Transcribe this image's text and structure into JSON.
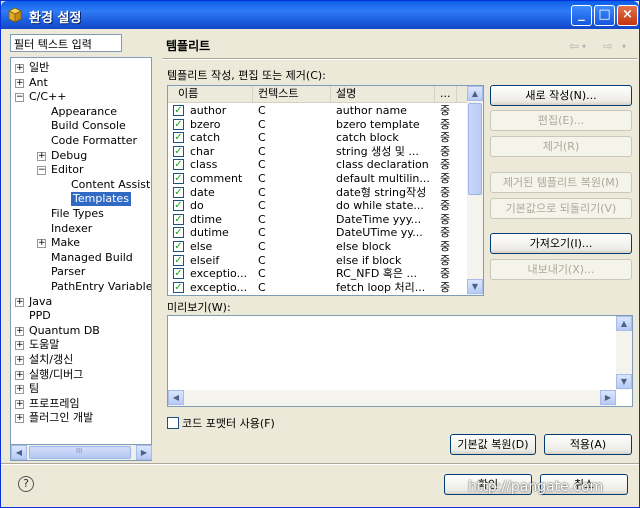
{
  "window": {
    "title": "환경 설정"
  },
  "filter": {
    "placeholder": "필터 텍스트 입력"
  },
  "tree": {
    "items": [
      {
        "label": "일반",
        "exp": "+"
      },
      {
        "label": "Ant",
        "exp": "+"
      },
      {
        "label": "C/C++",
        "exp": "−"
      },
      {
        "label": "Appearance",
        "exp": ""
      },
      {
        "label": "Build Console",
        "exp": ""
      },
      {
        "label": "Code Formatter",
        "exp": ""
      },
      {
        "label": "Debug",
        "exp": "+"
      },
      {
        "label": "Editor",
        "exp": "−"
      },
      {
        "label": "Content Assist",
        "exp": ""
      },
      {
        "label": "Templates",
        "exp": "",
        "selected": true
      },
      {
        "label": "File Types",
        "exp": ""
      },
      {
        "label": "Indexer",
        "exp": ""
      },
      {
        "label": "Make",
        "exp": "+"
      },
      {
        "label": "Managed Build",
        "exp": ""
      },
      {
        "label": "Parser",
        "exp": ""
      },
      {
        "label": "PathEntry Variable",
        "exp": ""
      },
      {
        "label": "Java",
        "exp": "+"
      },
      {
        "label": "PPD",
        "exp": ""
      },
      {
        "label": "Quantum DB",
        "exp": "+"
      },
      {
        "label": "도움말",
        "exp": "+"
      },
      {
        "label": "설치/갱신",
        "exp": "+"
      },
      {
        "label": "실행/디버그",
        "exp": "+"
      },
      {
        "label": "팀",
        "exp": "+"
      },
      {
        "label": "프로프레임",
        "exp": "+"
      },
      {
        "label": "플러그인 개발",
        "exp": "+"
      }
    ],
    "scroll_mark": "III"
  },
  "panel": {
    "title": "템플리트",
    "nav_back": "⇦",
    "nav_fwd": "⇨",
    "description": "템플리트 작성, 편집 또는 제거(C):"
  },
  "table": {
    "headers": [
      "이름",
      "컨텍스트",
      "설명",
      "..."
    ],
    "rows": [
      {
        "name": "author",
        "ctx": "C",
        "desc": "author name",
        "pat": "중"
      },
      {
        "name": "bzero",
        "ctx": "C",
        "desc": "bzero template",
        "pat": "중"
      },
      {
        "name": "catch",
        "ctx": "C",
        "desc": "catch block",
        "pat": "중"
      },
      {
        "name": "char",
        "ctx": "C",
        "desc": "string 생성 및 ...",
        "pat": "중"
      },
      {
        "name": "class",
        "ctx": "C",
        "desc": "class declaration",
        "pat": "중"
      },
      {
        "name": "comment",
        "ctx": "C",
        "desc": "default multilin...",
        "pat": "중"
      },
      {
        "name": "date",
        "ctx": "C",
        "desc": "date형 string작성",
        "pat": "중"
      },
      {
        "name": "do",
        "ctx": "C",
        "desc": "do while state...",
        "pat": "중"
      },
      {
        "name": "dtime",
        "ctx": "C",
        "desc": "DateTime yyy...",
        "pat": "중"
      },
      {
        "name": "dutime",
        "ctx": "C",
        "desc": "DateUTime yy...",
        "pat": "중"
      },
      {
        "name": "else",
        "ctx": "C",
        "desc": "else block",
        "pat": "중"
      },
      {
        "name": "elseif",
        "ctx": "C",
        "desc": "else if block",
        "pat": "중"
      },
      {
        "name": "exceptio...",
        "ctx": "C",
        "desc": "RC_NFD 혹은 ...",
        "pat": "중"
      },
      {
        "name": "exceptio...",
        "ctx": "C",
        "desc": "fetch loop 처리...",
        "pat": "중"
      }
    ]
  },
  "buttons": {
    "new": "새로 작성(N)...",
    "edit": "편집(E)...",
    "remove": "제거(R)",
    "restore_removed": "제거된 템플리트 복원(M)",
    "revert_default": "기본값으로 되돌리기(V)",
    "import": "가져오기(I)...",
    "export": "내보내기(X)...",
    "restore_defaults": "기본값 복원(D)",
    "apply": "적용(A)",
    "ok": "확인",
    "cancel": "취소"
  },
  "preview": {
    "label": "미리보기(W):"
  },
  "formatter": {
    "label": "코드 포맷터 사용(F)"
  },
  "watermark": "http://pangate.com"
}
